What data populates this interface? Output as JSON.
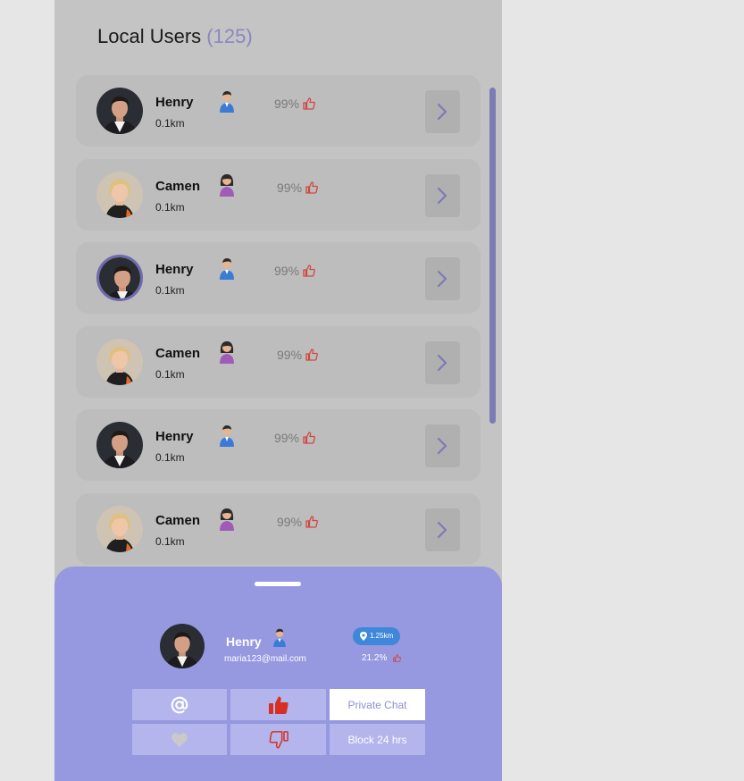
{
  "header": {
    "title": "Local Users",
    "count": "(125)"
  },
  "users": [
    {
      "name": "Henry",
      "distance": "0.1km",
      "gender": "male",
      "rating": "99%",
      "avatar": "male-avatar",
      "selected": false
    },
    {
      "name": "Camen",
      "distance": "0.1km",
      "gender": "female",
      "rating": "99%",
      "avatar": "female-avatar",
      "selected": false
    },
    {
      "name": "Henry",
      "distance": "0.1km",
      "gender": "male",
      "rating": "99%",
      "avatar": "male-avatar",
      "selected": true
    },
    {
      "name": "Camen",
      "distance": "0.1km",
      "gender": "female",
      "rating": "99%",
      "avatar": "female-avatar",
      "selected": false
    },
    {
      "name": "Henry",
      "distance": "0.1km",
      "gender": "male",
      "rating": "99%",
      "avatar": "male-avatar",
      "selected": false
    },
    {
      "name": "Camen",
      "distance": "0.1km",
      "gender": "female",
      "rating": "99%",
      "avatar": "female-avatar",
      "selected": false
    }
  ],
  "sheet": {
    "name": "Henry",
    "email": "maria123@mail.com",
    "location": "1.25km",
    "percent": "21.2%",
    "actions": {
      "mention_icon": "at-icon",
      "like_icon": "thumbs-up-icon",
      "private_chat": "Private Chat",
      "favorite_icon": "heart-icon",
      "dislike_icon": "thumbs-down-icon",
      "block": "Block 24 hrs"
    }
  },
  "colors": {
    "accent": "#9698e0",
    "accent_dark": "#6e6aad",
    "thumb_red": "#d0473f",
    "location_blue": "#3f87d8"
  }
}
